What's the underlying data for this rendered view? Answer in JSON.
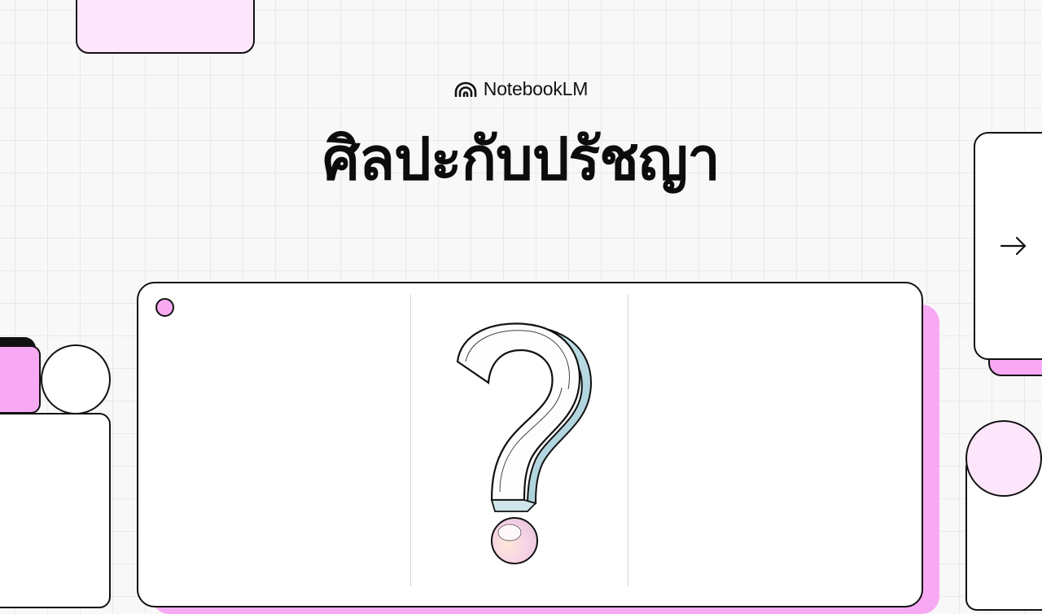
{
  "brand": {
    "name": "NotebookLM",
    "icon": "notebooklm-logo-icon"
  },
  "slide": {
    "title": "ศิลปะกับปรัชญา"
  },
  "illustration": {
    "icon": "question-mark-icon"
  },
  "navigation": {
    "next_icon": "arrow-right-icon"
  },
  "colors": {
    "accent_pink": "#f7a9f3",
    "light_pink": "#fde6fb",
    "outline": "#111111",
    "background": "#f8f8f8"
  }
}
